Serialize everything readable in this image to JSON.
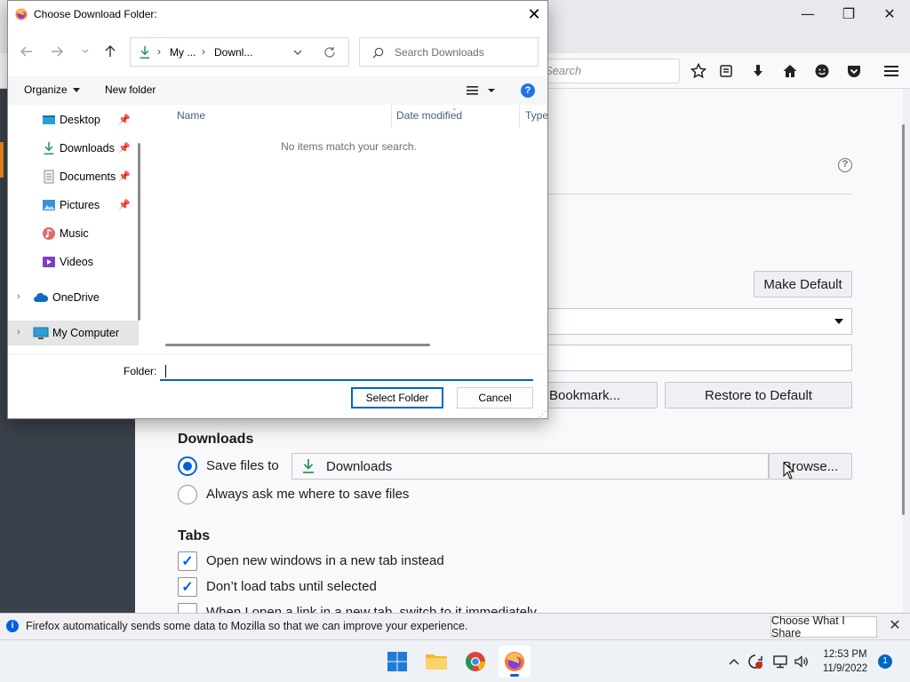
{
  "firefox": {
    "url_placeholder": "Search",
    "controls": {
      "minimize": "—",
      "maximize": "❐",
      "close": "✕"
    },
    "buttons": {
      "make_default": "Make Default",
      "bookmark": "Bookmark...",
      "restore_default": "Restore to Default",
      "browse": "Browse..."
    },
    "downloads": {
      "heading": "Downloads",
      "save_files_to": "Save files to",
      "folder": "Downloads",
      "always_ask": "Always ask me where to save files"
    },
    "tabs": {
      "heading": "Tabs",
      "open_new_windows": "Open new windows in a new tab instead",
      "dont_load_tabs": "Don’t load tabs until selected",
      "switch_to_tab": "When I open a link in a new tab, switch to it immediately"
    },
    "accent_color": "#0060df"
  },
  "notification": {
    "text": "Firefox automatically sends some data to Mozilla so that we can improve your experience.",
    "button": "Choose What I Share"
  },
  "dialog": {
    "title": "Choose Download Folder:",
    "address": {
      "part1": "My ...",
      "part2": "Downl..."
    },
    "search_placeholder": "Search Downloads",
    "organize": "Organize",
    "new_folder": "New folder",
    "nav_items": [
      {
        "label": "Desktop",
        "icon": "desktop-icon"
      },
      {
        "label": "Downloads",
        "icon": "download-icon"
      },
      {
        "label": "Documents",
        "icon": "documents-icon"
      },
      {
        "label": "Pictures",
        "icon": "pictures-icon"
      },
      {
        "label": "Music",
        "icon": "music-icon"
      },
      {
        "label": "Videos",
        "icon": "videos-icon"
      },
      {
        "label": "OneDrive",
        "icon": "onedrive-icon"
      },
      {
        "label": "My Computer",
        "icon": "computer-icon"
      }
    ],
    "columns": {
      "name": "Name",
      "date_modified": "Date modified",
      "type": "Type"
    },
    "empty_message": "No items match your search.",
    "folder_label": "Folder:",
    "folder_value": "",
    "select_folder": "Select Folder",
    "cancel": "Cancel"
  },
  "taskbar": {
    "time": "12:53 PM",
    "date": "11/9/2022",
    "notification_count": "1"
  }
}
